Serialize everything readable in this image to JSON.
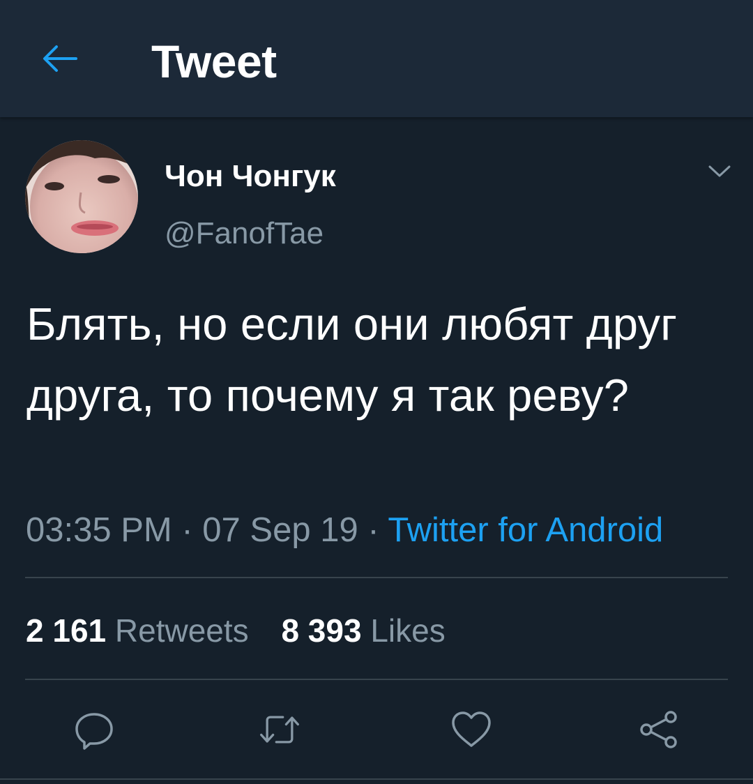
{
  "header": {
    "title": "Tweet",
    "back_icon": "back-arrow-icon"
  },
  "colors": {
    "background": "#15202b",
    "header": "#1c2938",
    "accent": "#1da1f2",
    "secondary_text": "#8899a6",
    "divider": "#38444d"
  },
  "tweet": {
    "author": {
      "display_name": "Чон Чонгук",
      "handle": "@FanofTae"
    },
    "text": "Блять, но если они любят друг друга, то почему я так реву?",
    "time": "03:35 PM",
    "date": "07 Sep 19",
    "separator": " · ",
    "source": "Twitter for Android",
    "stats": {
      "retweets_count": "2 161",
      "retweets_label": "Retweets",
      "likes_count": "8 393",
      "likes_label": "Likes"
    }
  },
  "actions": [
    "reply-icon",
    "retweet-icon",
    "like-icon",
    "share-icon"
  ]
}
